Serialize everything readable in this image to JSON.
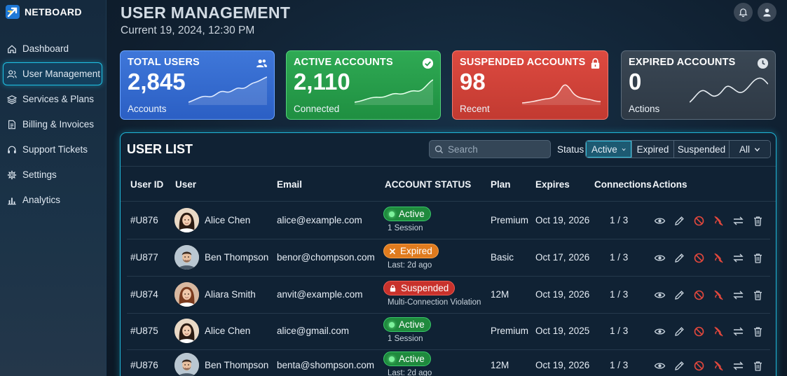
{
  "brand": {
    "name": "NETBOARD"
  },
  "sidebar": {
    "items": [
      {
        "label": "Dashboard",
        "icon": "home-icon"
      },
      {
        "label": "User Management",
        "icon": "users-icon",
        "active": true
      },
      {
        "label": "Services & Plans",
        "icon": "layers-icon"
      },
      {
        "label": "Billing & Invoices",
        "icon": "document-icon"
      },
      {
        "label": "Support Tickets",
        "icon": "headset-icon"
      },
      {
        "label": "Settings",
        "icon": "gear-icon"
      },
      {
        "label": "Analytics",
        "icon": "bar-chart-icon"
      }
    ]
  },
  "header": {
    "title": "USER MANAGEMENT",
    "subtitle": "Current 19, 2024, 12:30 PM",
    "icons": [
      "bell-icon",
      "user-icon"
    ]
  },
  "stats": [
    {
      "label": "TOTAL USERS",
      "value": "2,845",
      "sub": "Accounts",
      "icon": "users-icon",
      "color": "#3a72d6"
    },
    {
      "label": "ACTIVE ACCOUNTS",
      "value": "2,110",
      "sub": "Connected",
      "icon": "check-circle-icon",
      "color": "#27a04d"
    },
    {
      "label": "SUSPENDED ACCOUNTS",
      "value": "98",
      "sub": "Recent",
      "icon": "lock-icon",
      "color": "#d4433a"
    },
    {
      "label": "EXPIRED ACCOUNTS",
      "value": "0",
      "sub": "Actions",
      "icon": "clock-icon",
      "color": "#35414e"
    }
  ],
  "user_list": {
    "title": "USER LIST",
    "search_placeholder": "Search",
    "status_label": "Status",
    "filters": [
      {
        "label": "Active",
        "selected": true,
        "dropdown": true
      },
      {
        "label": "Expired"
      },
      {
        "label": "Suspended"
      },
      {
        "label": "All",
        "dropdown": true
      }
    ],
    "columns": [
      "User ID",
      "User",
      "Email",
      "ACCOUNT STATUS",
      "Plan",
      "Expires",
      "Connections",
      "Actions"
    ],
    "action_icons": [
      "eye-icon",
      "edit-icon",
      "ban-icon",
      "disconnect-icon",
      "transfer-icon",
      "trash-icon"
    ],
    "rows": [
      {
        "id": "#U876",
        "name": "Alice Chen",
        "email": "alice@example.com",
        "status": "Active",
        "status_type": "active",
        "status_sub": "1 Session",
        "plan": "Premium",
        "expires": "Oct 19, 2026",
        "connections": "1 / 3"
      },
      {
        "id": "#U877",
        "name": "Ben Thompson",
        "email": "benor@chompson.com",
        "status": "Expired",
        "status_type": "expired",
        "status_sub": "Last: 2d ago",
        "plan": "Basic",
        "expires": "Oct 17, 2026",
        "connections": "1 / 3"
      },
      {
        "id": "#U874",
        "name": "Aliara Smith",
        "email": "anvit@example.com",
        "status": "Suspended",
        "status_type": "suspended",
        "status_sub": "Multi-Connection Violation",
        "plan": "12M",
        "expires": "Oct 19, 2026",
        "connections": "1 / 3"
      },
      {
        "id": "#U875",
        "name": "Alice Chen",
        "email": "alice@gmail.com",
        "status": "Active",
        "status_type": "active",
        "status_sub": "1 Session",
        "plan": "Premium",
        "expires": "Oct 19, 2025",
        "connections": "1 / 3"
      },
      {
        "id": "#U876",
        "name": "Ben Thompson",
        "email": "benta@shompson.com",
        "status": "Active",
        "status_type": "active",
        "status_sub": "Last: 2d ago",
        "plan": "12M",
        "expires": "Oct 19, 2026",
        "connections": "1 / 3"
      }
    ]
  }
}
